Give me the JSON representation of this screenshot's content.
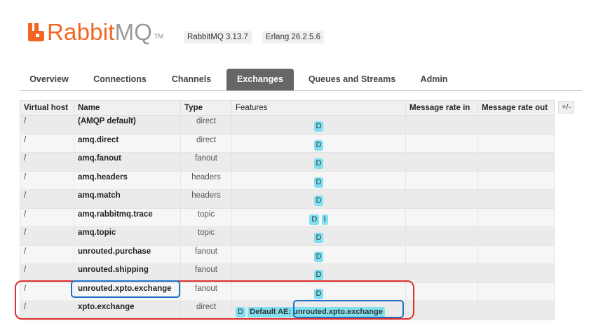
{
  "header": {
    "brand_rabbit": "Rabbit",
    "brand_mq": "MQ",
    "brand_tm": "TM",
    "rabbitmq_version": "RabbitMQ 3.13.7",
    "erlang_version": "Erlang 26.2.5.6",
    "brand_color": "#f26522"
  },
  "tabs": [
    {
      "label": "Overview",
      "active": false
    },
    {
      "label": "Connections",
      "active": false
    },
    {
      "label": "Channels",
      "active": false
    },
    {
      "label": "Exchanges",
      "active": true
    },
    {
      "label": "Queues and Streams",
      "active": false
    },
    {
      "label": "Admin",
      "active": false
    }
  ],
  "table": {
    "headers": [
      "Virtual host",
      "Name",
      "Type",
      "Features",
      "Message rate in",
      "Message rate out"
    ],
    "toggle_columns": "+/-",
    "rows": [
      {
        "vhost": "/",
        "name": "(AMQP default)",
        "type": "direct",
        "features": [
          "D"
        ]
      },
      {
        "vhost": "/",
        "name": "amq.direct",
        "type": "direct",
        "features": [
          "D"
        ]
      },
      {
        "vhost": "/",
        "name": "amq.fanout",
        "type": "fanout",
        "features": [
          "D"
        ]
      },
      {
        "vhost": "/",
        "name": "amq.headers",
        "type": "headers",
        "features": [
          "D"
        ]
      },
      {
        "vhost": "/",
        "name": "amq.match",
        "type": "headers",
        "features": [
          "D"
        ]
      },
      {
        "vhost": "/",
        "name": "amq.rabbitmq.trace",
        "type": "topic",
        "features": [
          "D",
          "I"
        ]
      },
      {
        "vhost": "/",
        "name": "amq.topic",
        "type": "topic",
        "features": [
          "D"
        ]
      },
      {
        "vhost": "/",
        "name": "unrouted.purchase",
        "type": "fanout",
        "features": [
          "D"
        ]
      },
      {
        "vhost": "/",
        "name": "unrouted.shipping",
        "type": "fanout",
        "features": [
          "D"
        ]
      },
      {
        "vhost": "/",
        "name": "unrouted.xpto.exchange",
        "type": "fanout",
        "features": [
          "D"
        ]
      },
      {
        "vhost": "/",
        "name": "xpto.exchange",
        "type": "direct",
        "features": [
          "D"
        ],
        "alternate_exchange_label": "Default AE:",
        "alternate_exchange_value": "unrouted.xpto.exchange"
      }
    ]
  },
  "colors": {
    "feature_badge": "#80e0f0",
    "active_tab": "#666666",
    "highlight_red": "#e03030",
    "highlight_blue": "#1f6fc5"
  }
}
